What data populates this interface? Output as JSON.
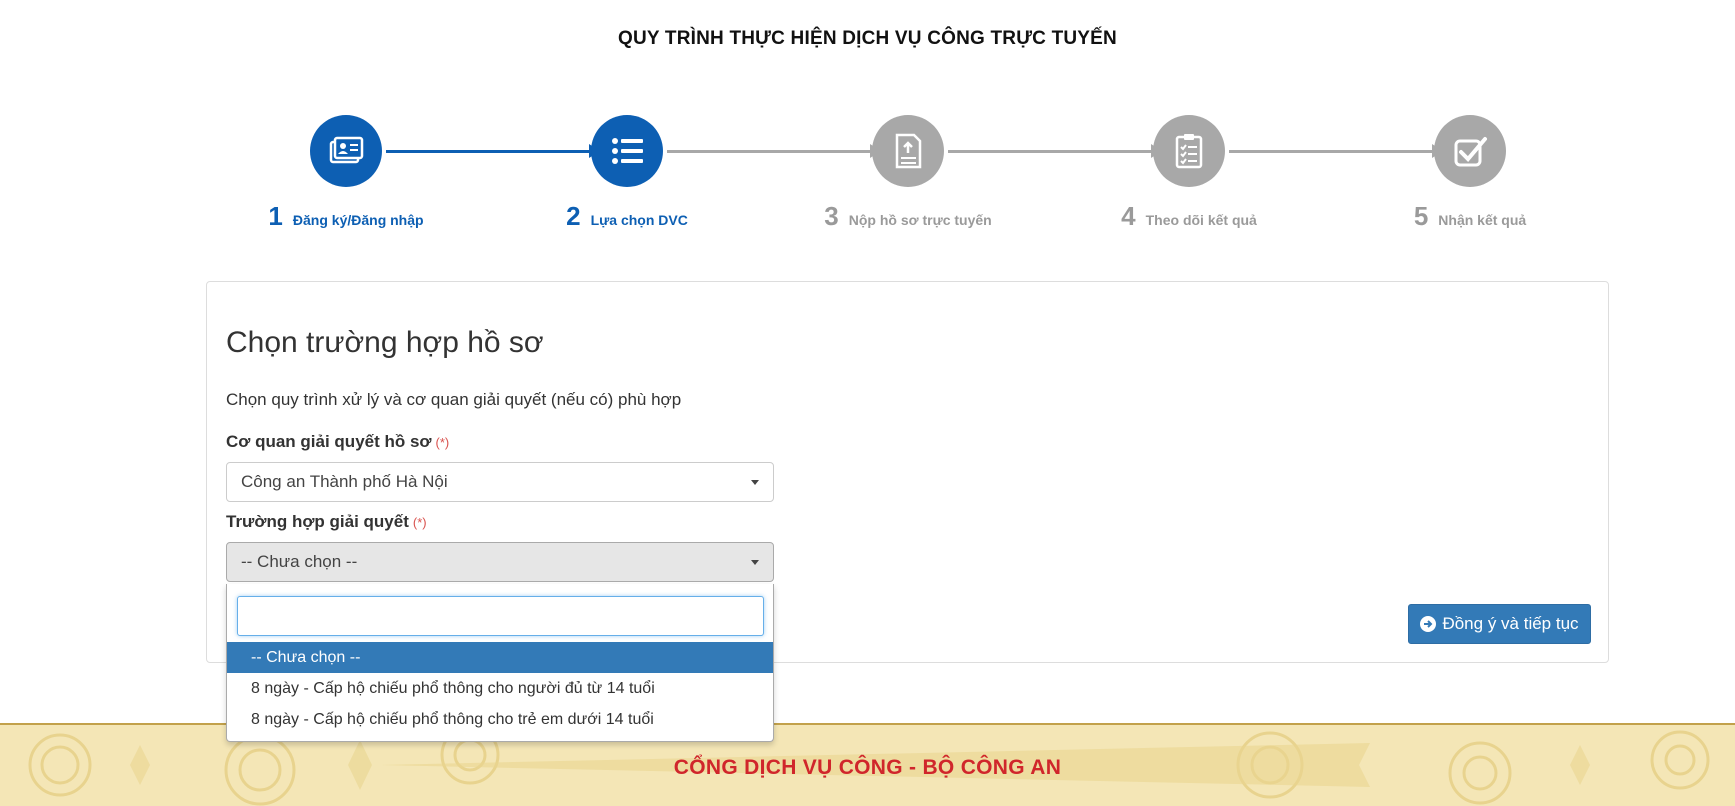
{
  "page": {
    "process_title": "QUY TRÌNH THỰC HIỆN DỊCH VỤ CÔNG TRỰC TUYẾN"
  },
  "steps": [
    {
      "number": "1",
      "label": "Đăng ký/Đăng nhập",
      "status": "active",
      "icon": "id-card-icon"
    },
    {
      "number": "2",
      "label": "Lựa chọn DVC",
      "status": "active",
      "icon": "list-icon"
    },
    {
      "number": "3",
      "label": "Nộp hồ sơ trực tuyến",
      "status": "inactive",
      "icon": "document-upload-icon"
    },
    {
      "number": "4",
      "label": "Theo dõi kết quả",
      "status": "inactive",
      "icon": "clipboard-checklist-icon"
    },
    {
      "number": "5",
      "label": "Nhận kết quả",
      "status": "inactive",
      "icon": "checkbox-icon"
    }
  ],
  "colors": {
    "active": "#0d5fb3",
    "inactive": "#a8a8a8",
    "primary_button": "#337ab7",
    "required": "#d9534f",
    "footer_title": "#d0262b",
    "footer_bg": "#f4e6b6"
  },
  "panel": {
    "title": "Chọn trường hợp hồ sơ",
    "description": "Chọn quy trình xử lý và cơ quan giải quyết (nếu có) phù hợp",
    "agency": {
      "label": "Cơ quan giải quyết hồ sơ",
      "required_mark": "(*)",
      "value": "Công an Thành phố Hà Nội"
    },
    "case": {
      "label": "Trường hợp giải quyết",
      "required_mark": "(*)",
      "value": "-- Chưa chọn --"
    },
    "continue_button": "Đồng ý và tiếp tục"
  },
  "dropdown": {
    "search_value": "",
    "options": [
      "-- Chưa chọn --",
      "8 ngày - Cấp hộ chiếu phổ thông cho người đủ từ 14 tuổi",
      "8 ngày - Cấp hộ chiếu phổ thông cho trẻ em dưới 14 tuổi"
    ],
    "selected_index": 0
  },
  "footer": {
    "title": "CỔNG DỊCH VỤ CÔNG - BỘ CÔNG AN"
  }
}
